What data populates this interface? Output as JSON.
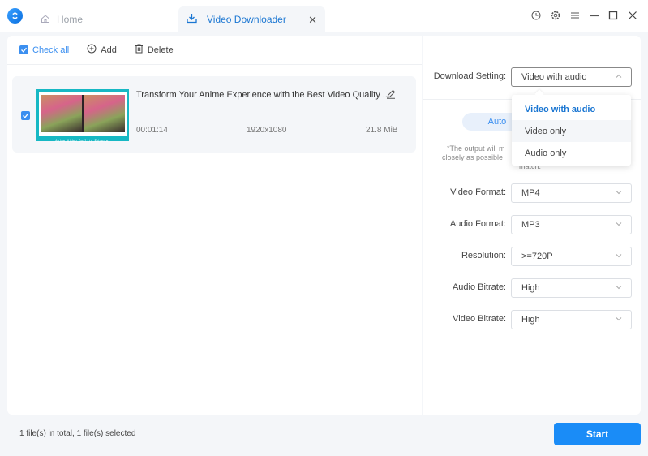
{
  "titlebar": {
    "tabs": [
      {
        "label": "Home",
        "icon": "home-icon",
        "active": false
      },
      {
        "label": "Video Downloader",
        "icon": "download-icon",
        "active": true
      }
    ],
    "controls": [
      "history-icon",
      "settings-icon",
      "menu-icon",
      "minimize-icon",
      "maximize-icon",
      "close-icon"
    ]
  },
  "toolbar": {
    "check_all_label": "Check all",
    "add_label": "Add",
    "delete_label": "Delete"
  },
  "files": [
    {
      "title": "Transform Your Anime Experience with the Best Video Quality ...",
      "duration": "00:01:14",
      "resolution": "1920x1080",
      "size": "21.8 MiB",
      "checked": true,
      "thumbnail_caption": "Anime Video Quality Enhancer"
    }
  ],
  "settings": {
    "download_setting_label": "Download Setting:",
    "download_setting_value": "Video with audio",
    "download_options": [
      "Video with audio",
      "Video only",
      "Audio only"
    ],
    "auto_label": "Auto",
    "note_line1": "*The output will m",
    "note_line2": "closely as possible",
    "note_line3": "match.",
    "video_format_label": "Video Format:",
    "video_format_value": "MP4",
    "audio_format_label": "Audio Format:",
    "audio_format_value": "MP3",
    "resolution_label": "Resolution:",
    "resolution_value": ">=720P",
    "audio_bitrate_label": "Audio Bitrate:",
    "audio_bitrate_value": "High",
    "video_bitrate_label": "Video Bitrate:",
    "video_bitrate_value": "High"
  },
  "status": {
    "summary": "1 file(s) in total, 1 file(s) selected",
    "start_label": "Start"
  },
  "colors": {
    "accent": "#1a8cf7",
    "active_tab_text": "#1a76d2"
  }
}
